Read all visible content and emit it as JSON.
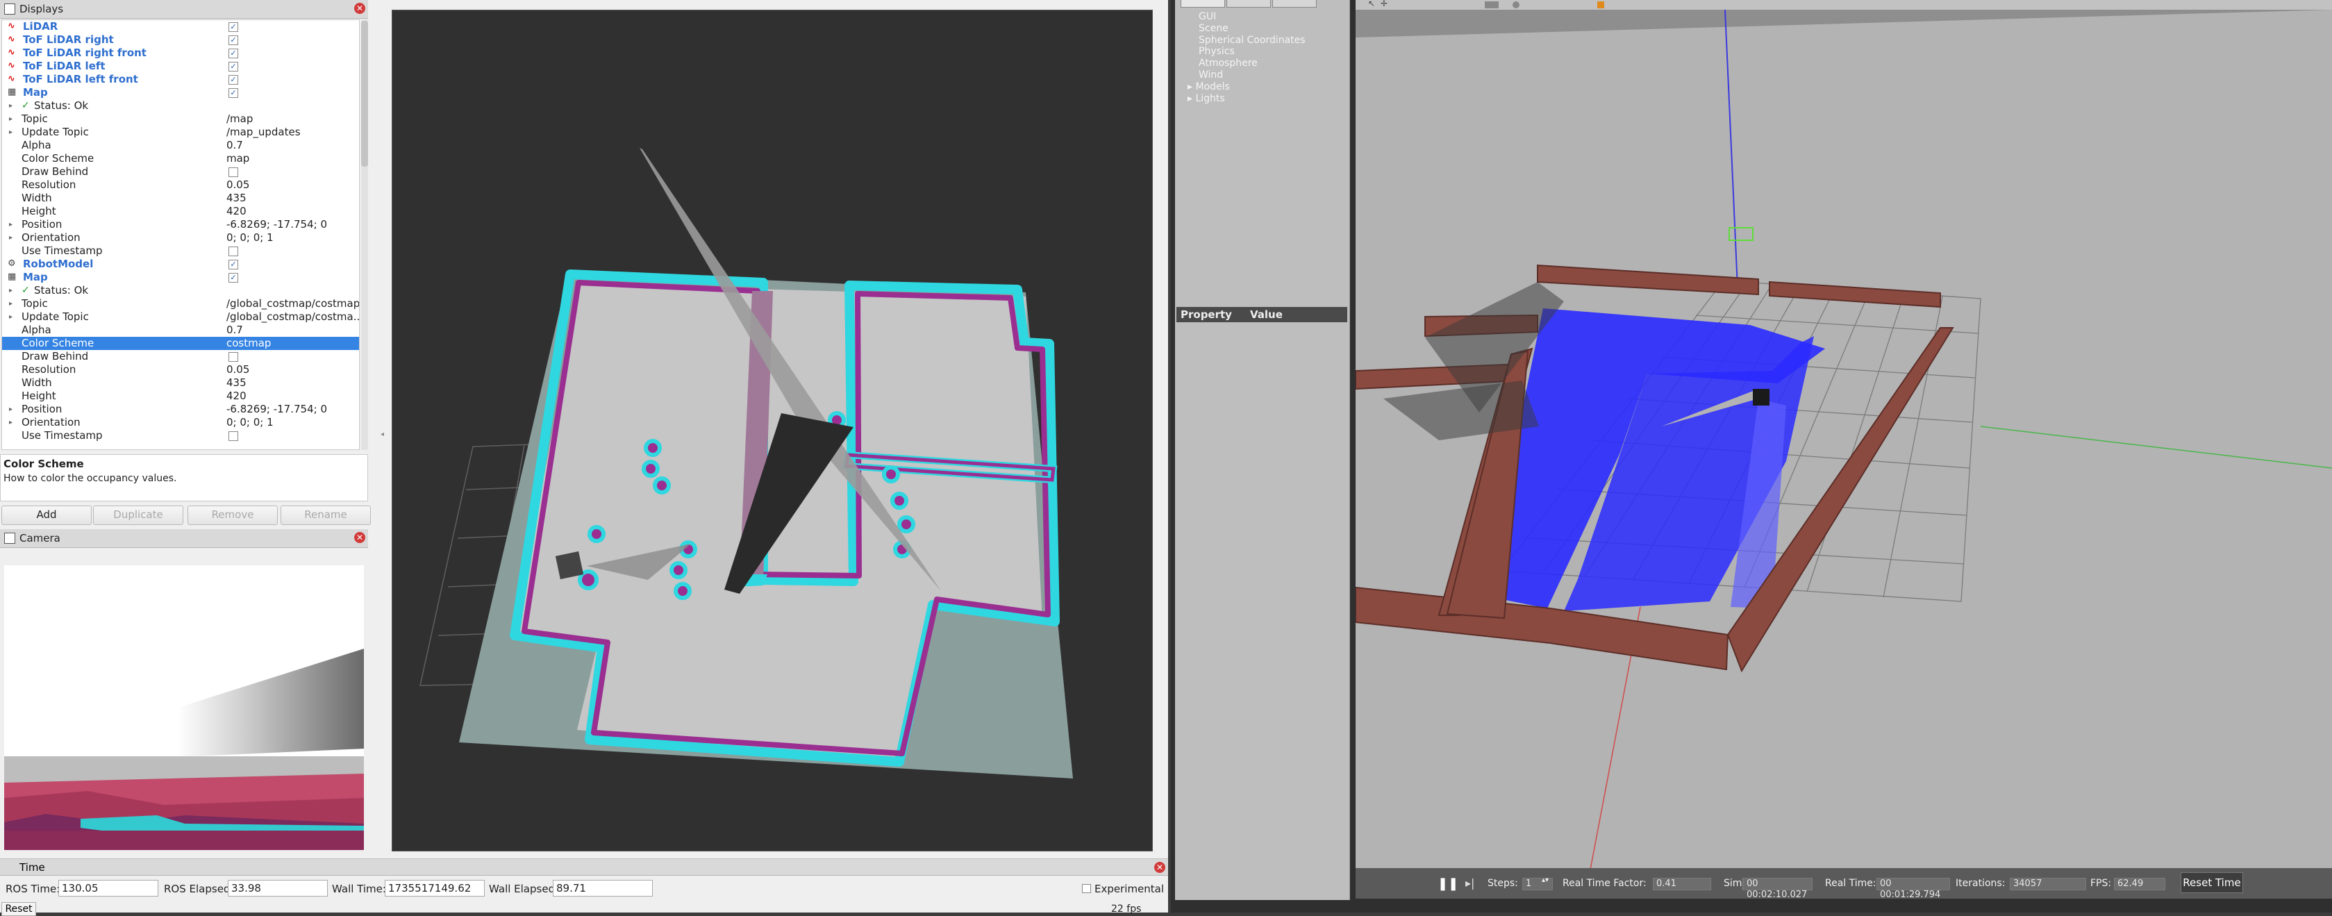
{
  "rviz": {
    "displays_panel": {
      "title": "Displays",
      "rows": [
        {
          "name": "LiDAR",
          "checked": true,
          "kind": "top"
        },
        {
          "name": "ToF LiDAR right",
          "checked": true,
          "kind": "top"
        },
        {
          "name": "ToF LiDAR right front",
          "checked": true,
          "kind": "top"
        },
        {
          "name": "ToF LiDAR left",
          "checked": true,
          "kind": "top"
        },
        {
          "name": "ToF LiDAR left front",
          "checked": true,
          "kind": "top"
        },
        {
          "name": "Map",
          "checked": true,
          "kind": "top"
        },
        {
          "name": "Status: Ok",
          "kind": "status"
        },
        {
          "name": "Topic",
          "value": "/map",
          "kind": "prop",
          "expand": true
        },
        {
          "name": "Update Topic",
          "value": "/map_updates",
          "kind": "prop",
          "expand": true
        },
        {
          "name": "Alpha",
          "value": "0.7",
          "kind": "prop"
        },
        {
          "name": "Color Scheme",
          "value": "map",
          "kind": "prop"
        },
        {
          "name": "Draw Behind",
          "checked": false,
          "kind": "propchk"
        },
        {
          "name": "Resolution",
          "value": "0.05",
          "kind": "prop"
        },
        {
          "name": "Width",
          "value": "435",
          "kind": "prop"
        },
        {
          "name": "Height",
          "value": "420",
          "kind": "prop"
        },
        {
          "name": "Position",
          "value": "-6.8269; -17.754; 0",
          "kind": "prop",
          "expand": true
        },
        {
          "name": "Orientation",
          "value": "0; 0; 0; 1",
          "kind": "prop",
          "expand": true
        },
        {
          "name": "Use Timestamp",
          "checked": false,
          "kind": "propchk"
        },
        {
          "name": "RobotModel",
          "checked": true,
          "kind": "top"
        },
        {
          "name": "Map",
          "checked": true,
          "kind": "top"
        },
        {
          "name": "Status: Ok",
          "kind": "status"
        },
        {
          "name": "Topic",
          "value": "/global_costmap/costmap",
          "kind": "prop",
          "expand": true
        },
        {
          "name": "Update Topic",
          "value": "/global_costmap/costma...",
          "kind": "prop",
          "expand": true
        },
        {
          "name": "Alpha",
          "value": "0.7",
          "kind": "prop"
        },
        {
          "name": "Color Scheme",
          "value": "costmap",
          "kind": "prop",
          "selected": true
        },
        {
          "name": "Draw Behind",
          "checked": false,
          "kind": "propchk"
        },
        {
          "name": "Resolution",
          "value": "0.05",
          "kind": "prop"
        },
        {
          "name": "Width",
          "value": "435",
          "kind": "prop"
        },
        {
          "name": "Height",
          "value": "420",
          "kind": "prop"
        },
        {
          "name": "Position",
          "value": "-6.8269; -17.754; 0",
          "kind": "prop",
          "expand": true
        },
        {
          "name": "Orientation",
          "value": "0; 0; 0; 1",
          "kind": "prop",
          "expand": true
        },
        {
          "name": "Use Timestamp",
          "checked": false,
          "kind": "propchk"
        }
      ]
    },
    "description": {
      "title": "Color Scheme",
      "text": "How to color the occupancy values."
    },
    "buttons": {
      "add": "Add",
      "duplicate": "Duplicate",
      "remove": "Remove",
      "rename": "Rename"
    },
    "camera_panel": {
      "title": "Camera"
    },
    "time_panel": {
      "title": "Time",
      "ros_time_label": "ROS Time:",
      "ros_time": "130.05",
      "ros_elapsed_label": "ROS Elapsed:",
      "ros_elapsed": "33.98",
      "wall_time_label": "Wall Time:",
      "wall_time": "1735517149.62",
      "wall_elapsed_label": "Wall Elapsed:",
      "wall_elapsed": "89.71",
      "experimental": "Experimental",
      "reset": "Reset",
      "fps": "22 fps"
    },
    "colors": {
      "costmap_cyan": "#2fd7e0",
      "costmap_magenta": "#9a2e91",
      "map_gray": "#c8c8c8",
      "selection_blue": "#3584e4"
    }
  },
  "gazebo": {
    "world_items": [
      "GUI",
      "Scene",
      "Spherical Coordinates",
      "Physics",
      "Atmosphere",
      "Wind",
      "Models",
      "Lights"
    ],
    "property_header": {
      "property": "Property",
      "value": "Value"
    },
    "bottom_bar": {
      "steps_label": "Steps:",
      "steps_value": "1",
      "rtf_label": "Real Time Factor:",
      "rtf_value": "0.41",
      "sim_time_label": "Sim Time:",
      "sim_time_value": "00 00:02:10.027",
      "real_time_label": "Real Time:",
      "real_time_value": "00 00:01:29.794",
      "iterations_label": "Iterations:",
      "iterations_value": "34057",
      "fps_label": "FPS:",
      "fps_value": "62.49",
      "reset_time": "Reset Time"
    },
    "colors": {
      "laser_blue": "#2a2aff",
      "brick": "#8a4a40",
      "ground": "#b3b3b3"
    }
  }
}
